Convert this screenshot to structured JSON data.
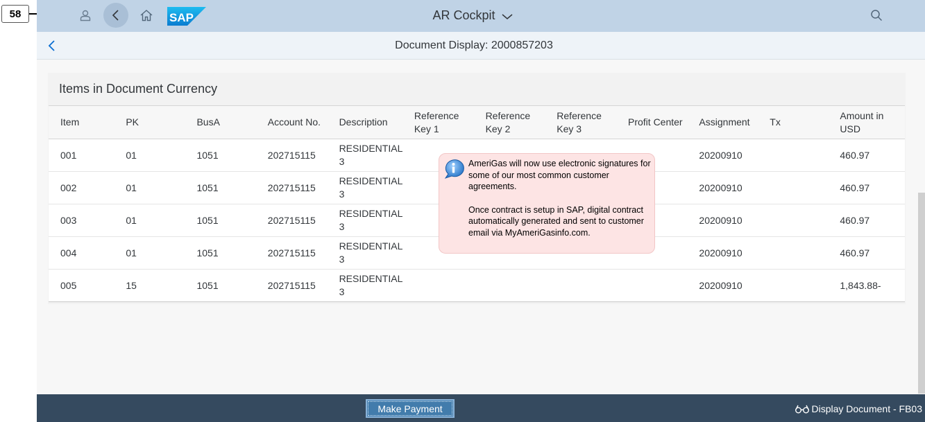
{
  "step": {
    "number": "58"
  },
  "shell": {
    "title": "AR Cockpit",
    "logo_text": "SAP",
    "icons": {
      "user": "user-icon",
      "back": "back-icon",
      "home": "home-icon",
      "search": "search-icon",
      "title_menu": "chevron-down-icon"
    }
  },
  "subheader": {
    "title": "Document Display: 2000857203",
    "back_icon": "chevron-left-icon"
  },
  "panel": {
    "title": "Items in Document Currency",
    "columns": [
      "Item",
      "PK",
      "BusA",
      "Account No.",
      "Description",
      "Reference Key 1",
      "Reference Key 2",
      "Reference Key 3",
      "Profit Center",
      "Assignment",
      "Tx",
      "Amount in USD"
    ],
    "rows": [
      [
        "001",
        "01",
        "1051",
        "202715115",
        "RESIDENTIAL 3",
        "",
        "",
        "",
        "",
        "20200910",
        "",
        "460.97"
      ],
      [
        "002",
        "01",
        "1051",
        "202715115",
        "RESIDENTIAL 3",
        "",
        "",
        "",
        "",
        "20200910",
        "",
        "460.97"
      ],
      [
        "003",
        "01",
        "1051",
        "202715115",
        "RESIDENTIAL 3",
        "",
        "",
        "",
        "",
        "20200910",
        "",
        "460.97"
      ],
      [
        "004",
        "01",
        "1051",
        "202715115",
        "RESIDENTIAL 3",
        "",
        "",
        "",
        "",
        "20200910",
        "",
        "460.97"
      ],
      [
        "005",
        "15",
        "1051",
        "202715115",
        "RESIDENTIAL 3",
        "",
        "",
        "",
        "",
        "20200910",
        "",
        "1,843.88-"
      ]
    ]
  },
  "note": {
    "icon": "info-icon",
    "paragraph1": "AmeriGas will now use electronic signatures for some of our most common customer agreements.",
    "paragraph2": "Once contract is setup in SAP, digital contract automatically generated and sent to customer email via MyAmeriGasinfo.com."
  },
  "footer": {
    "make_payment_label": "Make Payment",
    "transaction_label": "Display Document - FB03",
    "transaction_icon": "glasses-icon"
  },
  "colors": {
    "shell_bg": "#c0d3e6",
    "footer_bg": "#354a5f",
    "button_bg": "#427cac",
    "note_bg": "#fde4e4",
    "link_blue": "#0a6ed1"
  }
}
